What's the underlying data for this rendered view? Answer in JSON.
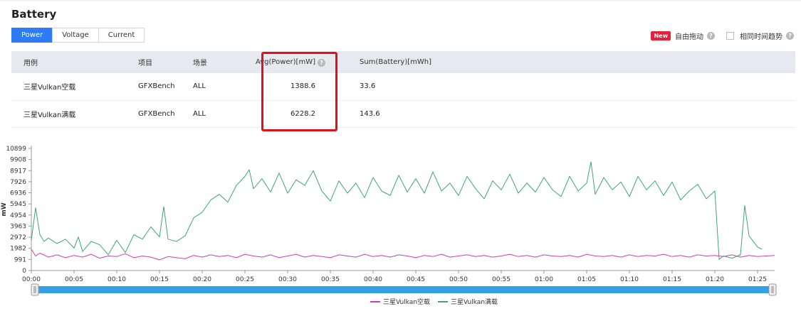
{
  "page": {
    "title": "Battery"
  },
  "tabs": [
    {
      "label": "Power",
      "active": true
    },
    {
      "label": "Voltage",
      "active": false
    },
    {
      "label": "Current",
      "active": false
    }
  ],
  "options": {
    "new_badge": "New",
    "free_drag_label": "自由拖动",
    "same_time_trend_label": "相同时间趋势",
    "help_glyph": "?"
  },
  "table": {
    "headers": [
      "用例",
      "项目",
      "场景",
      "Avg(Power)[mW]",
      "Sum(Battery)[mWh]"
    ],
    "rows": [
      [
        "三星Vulkan空载",
        "GFXBench",
        "ALL",
        "1388.6",
        "33.6"
      ],
      [
        "三星Vulkan满载",
        "GFXBench",
        "ALL",
        "6228.2",
        "143.6"
      ]
    ]
  },
  "colors": {
    "accent": "#2d7cf6",
    "series_idle": "#cc3fb0",
    "series_full": "#3fa57a",
    "highlight": "#e0101c",
    "badge": "#e8203a"
  },
  "chart_data": {
    "type": "line",
    "ylabel": "mW",
    "xlabel": "",
    "yticks": [
      0,
      991,
      1982,
      2972,
      3963,
      4954,
      5945,
      6936,
      7926,
      8917,
      9908,
      10899
    ],
    "ylim": [
      0,
      10899
    ],
    "xticks": [
      "00:00",
      "00:05",
      "00:10",
      "00:15",
      "00:20",
      "00:25",
      "00:30",
      "00:35",
      "00:40",
      "00:45",
      "00:50",
      "00:55",
      "01:00",
      "01:05",
      "01:10",
      "01:15",
      "01:20",
      "01:25"
    ],
    "x_unit": "minutes",
    "xlim": [
      0,
      87
    ],
    "grid": false,
    "legend": "bottom-center",
    "series": [
      {
        "name": "三星Vulkan空载",
        "color": "#cc3fb0",
        "points": [
          [
            0,
            1900
          ],
          [
            0.5,
            1300
          ],
          [
            1,
            1550
          ],
          [
            2,
            1200
          ],
          [
            3,
            1400
          ],
          [
            4,
            1150
          ],
          [
            5,
            1350
          ],
          [
            6,
            1200
          ],
          [
            7,
            1450
          ],
          [
            8,
            1100
          ],
          [
            9,
            1300
          ],
          [
            10,
            1250
          ],
          [
            11,
            1500
          ],
          [
            12,
            1150
          ],
          [
            13,
            1300
          ],
          [
            14,
            1200
          ],
          [
            15,
            950
          ],
          [
            16,
            1250
          ],
          [
            17,
            1150
          ],
          [
            18,
            1050
          ],
          [
            19,
            1350
          ],
          [
            20,
            1200
          ],
          [
            21,
            1400
          ],
          [
            22,
            1250
          ],
          [
            23,
            1350
          ],
          [
            24,
            1150
          ],
          [
            25,
            1450
          ],
          [
            26,
            1300
          ],
          [
            27,
            1200
          ],
          [
            28,
            1400
          ],
          [
            29,
            1150
          ],
          [
            30,
            1300
          ],
          [
            31,
            1450
          ],
          [
            32,
            1200
          ],
          [
            33,
            1350
          ],
          [
            34,
            1250
          ],
          [
            35,
            1150
          ],
          [
            36,
            1400
          ],
          [
            37,
            1300
          ],
          [
            38,
            1200
          ],
          [
            39,
            1450
          ],
          [
            40,
            1250
          ],
          [
            41,
            1350
          ],
          [
            42,
            1200
          ],
          [
            43,
            1400
          ],
          [
            44,
            1300
          ],
          [
            45,
            1150
          ],
          [
            46,
            1350
          ],
          [
            47,
            1250
          ],
          [
            48,
            1450
          ],
          [
            49,
            1200
          ],
          [
            50,
            1300
          ],
          [
            51,
            1400
          ],
          [
            52,
            1250
          ],
          [
            53,
            1350
          ],
          [
            54,
            1200
          ],
          [
            55,
            1300
          ],
          [
            56,
            1450
          ],
          [
            57,
            1250
          ],
          [
            58,
            1350
          ],
          [
            59,
            1200
          ],
          [
            60,
            1400
          ],
          [
            61,
            1300
          ],
          [
            62,
            1250
          ],
          [
            63,
            1350
          ],
          [
            64,
            1200
          ],
          [
            65,
            1450
          ],
          [
            66,
            1300
          ],
          [
            67,
            1250
          ],
          [
            68,
            1350
          ],
          [
            69,
            1200
          ],
          [
            70,
            1400
          ],
          [
            71,
            1250
          ],
          [
            72,
            1350
          ],
          [
            73,
            1300
          ],
          [
            74,
            1450
          ],
          [
            75,
            1250
          ],
          [
            76,
            1350
          ],
          [
            77,
            1200
          ],
          [
            78,
            1400
          ],
          [
            79,
            1300
          ],
          [
            80,
            1350
          ],
          [
            81,
            1250
          ],
          [
            82,
            1400
          ],
          [
            83,
            1200
          ],
          [
            84,
            1350
          ],
          [
            85,
            1250
          ],
          [
            86,
            1300
          ],
          [
            87,
            1350
          ]
        ]
      },
      {
        "name": "三星Vulkan满载",
        "color": "#3fa57a",
        "points": [
          [
            0,
            2700
          ],
          [
            0.5,
            5600
          ],
          [
            1,
            3200
          ],
          [
            1.5,
            2600
          ],
          [
            2,
            2900
          ],
          [
            3,
            2400
          ],
          [
            4,
            2800
          ],
          [
            5,
            2000
          ],
          [
            5.5,
            3000
          ],
          [
            6,
            1700
          ],
          [
            7,
            2600
          ],
          [
            8,
            2300
          ],
          [
            9,
            1400
          ],
          [
            10,
            2700
          ],
          [
            11,
            1600
          ],
          [
            12,
            3200
          ],
          [
            13,
            2800
          ],
          [
            14,
            3900
          ],
          [
            15,
            3000
          ],
          [
            15.5,
            5700
          ],
          [
            16,
            2800
          ],
          [
            17,
            2600
          ],
          [
            18,
            3100
          ],
          [
            19,
            4700
          ],
          [
            20,
            5200
          ],
          [
            21,
            6300
          ],
          [
            22,
            6800
          ],
          [
            23,
            6100
          ],
          [
            24,
            7600
          ],
          [
            25,
            8400
          ],
          [
            25.5,
            9000
          ],
          [
            26,
            7300
          ],
          [
            27,
            8200
          ],
          [
            28,
            7000
          ],
          [
            29,
            8700
          ],
          [
            30,
            6900
          ],
          [
            31,
            8100
          ],
          [
            32,
            7600
          ],
          [
            33,
            8900
          ],
          [
            34,
            7100
          ],
          [
            35,
            6200
          ],
          [
            36,
            8000
          ],
          [
            37,
            6900
          ],
          [
            38,
            7800
          ],
          [
            39,
            6500
          ],
          [
            40,
            8300
          ],
          [
            41,
            7100
          ],
          [
            42,
            6700
          ],
          [
            43,
            8500
          ],
          [
            44,
            7000
          ],
          [
            45,
            8200
          ],
          [
            46,
            6900
          ],
          [
            47,
            8800
          ],
          [
            48,
            7100
          ],
          [
            49,
            7800
          ],
          [
            50,
            6700
          ],
          [
            51,
            8400
          ],
          [
            52,
            7300
          ],
          [
            53,
            6400
          ],
          [
            54,
            8000
          ],
          [
            55,
            7200
          ],
          [
            56,
            8600
          ],
          [
            57,
            6900
          ],
          [
            58,
            7800
          ],
          [
            59,
            7000
          ],
          [
            60,
            8300
          ],
          [
            61,
            7200
          ],
          [
            62,
            6600
          ],
          [
            63,
            8400
          ],
          [
            64,
            7100
          ],
          [
            65,
            7800
          ],
          [
            65.5,
            9700
          ],
          [
            66,
            6800
          ],
          [
            67,
            8300
          ],
          [
            68,
            7200
          ],
          [
            69,
            7900
          ],
          [
            70,
            6600
          ],
          [
            71,
            8400
          ],
          [
            72,
            7200
          ],
          [
            73,
            8000
          ],
          [
            74,
            6700
          ],
          [
            75,
            7900
          ],
          [
            76,
            6300
          ],
          [
            77,
            7100
          ],
          [
            78,
            7700
          ],
          [
            79,
            6400
          ],
          [
            80,
            7100
          ],
          [
            80.5,
            1000
          ],
          [
            81,
            1300
          ],
          [
            82,
            1100
          ],
          [
            83,
            1400
          ],
          [
            83.5,
            5800
          ],
          [
            84,
            3100
          ],
          [
            85,
            2100
          ],
          [
            85.5,
            1900
          ]
        ]
      }
    ]
  }
}
